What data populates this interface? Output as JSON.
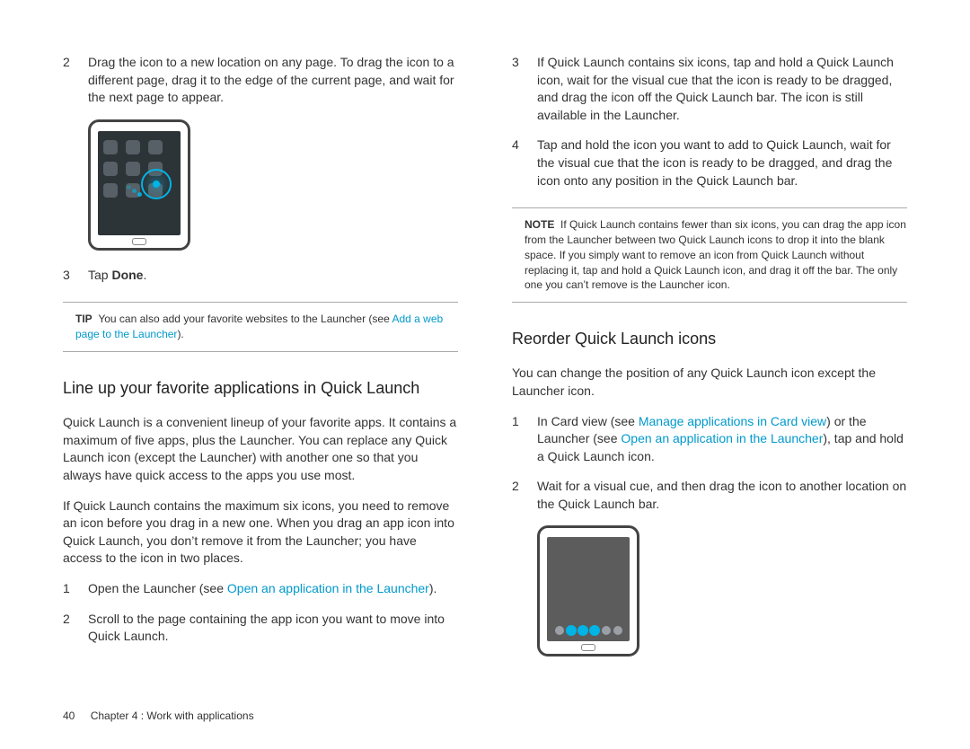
{
  "col1": {
    "step2_num": "2",
    "step2_text": "Drag the icon to a new location on any page. To drag the icon to a different page, drag it to the edge of the current page, and wait for the next page to appear.",
    "step3_num": "3",
    "step3_prefix": "Tap ",
    "step3_bold": "Done",
    "step3_suffix": ".",
    "tip_label": "TIP",
    "tip_text_a": "You can also add your favorite websites to the Launcher (see ",
    "tip_link": "Add a web page to the Launcher",
    "tip_text_b": ").",
    "h_lineup": "Line up your favorite applications in Quick Launch",
    "p1": "Quick Launch is a convenient lineup of your favorite apps. It contains a maximum of five apps, plus the Launcher. You can replace any Quick Launch icon (except the Launcher) with another one so that you always have quick access to the apps you use most.",
    "p2": "If Quick Launch contains the maximum six icons, you need to remove an icon before you drag in a new one. When you drag an app icon into Quick Launch, you don’t remove it from the Launcher; you have access to the icon in two places.",
    "s1_num": "1",
    "s1_a": "Open the Launcher (see ",
    "s1_link": "Open an application in the Launcher",
    "s1_b": ").",
    "s2_num": "2",
    "s2_text": "Scroll to the page containing the app icon you want to move into Quick Launch."
  },
  "col2": {
    "s3_num": "3",
    "s3_text": "If Quick Launch contains six icons, tap and hold a Quick Launch icon, wait for the visual cue that the icon is ready to be dragged, and drag the icon off the Quick Launch bar. The icon is still available in the Launcher.",
    "s4_num": "4",
    "s4_text": "Tap and hold the icon you want to add to Quick Launch, wait for the visual cue that the icon is ready to be dragged, and drag the icon onto any position in the Quick Launch bar.",
    "note_label": "NOTE",
    "note_text": "If Quick Launch contains fewer than six icons, you can drag the app icon from the Launcher between two Quick Launch icons to drop it into the blank space. If you simply want to remove an icon from Quick Launch without replacing it, tap and hold a Quick Launch icon, and drag it off the bar. The only one you can’t remove is the Launcher icon.",
    "h_reorder": "Reorder Quick Launch icons",
    "p3": "You can change the position of any Quick Launch icon except the Launcher icon.",
    "r1_num": "1",
    "r1_a": "In Card view (see ",
    "r1_link1": "Manage applications in Card view",
    "r1_b": ") or the Launcher (see ",
    "r1_link2": "Open an application in the Launcher",
    "r1_c": "), tap and hold a Quick Launch icon.",
    "r2_num": "2",
    "r2_text": "Wait for a visual cue, and then drag the icon to another location on the Quick Launch bar."
  },
  "footer": {
    "page_num": "40",
    "chapter": "Chapter 4 : Work with applications"
  }
}
